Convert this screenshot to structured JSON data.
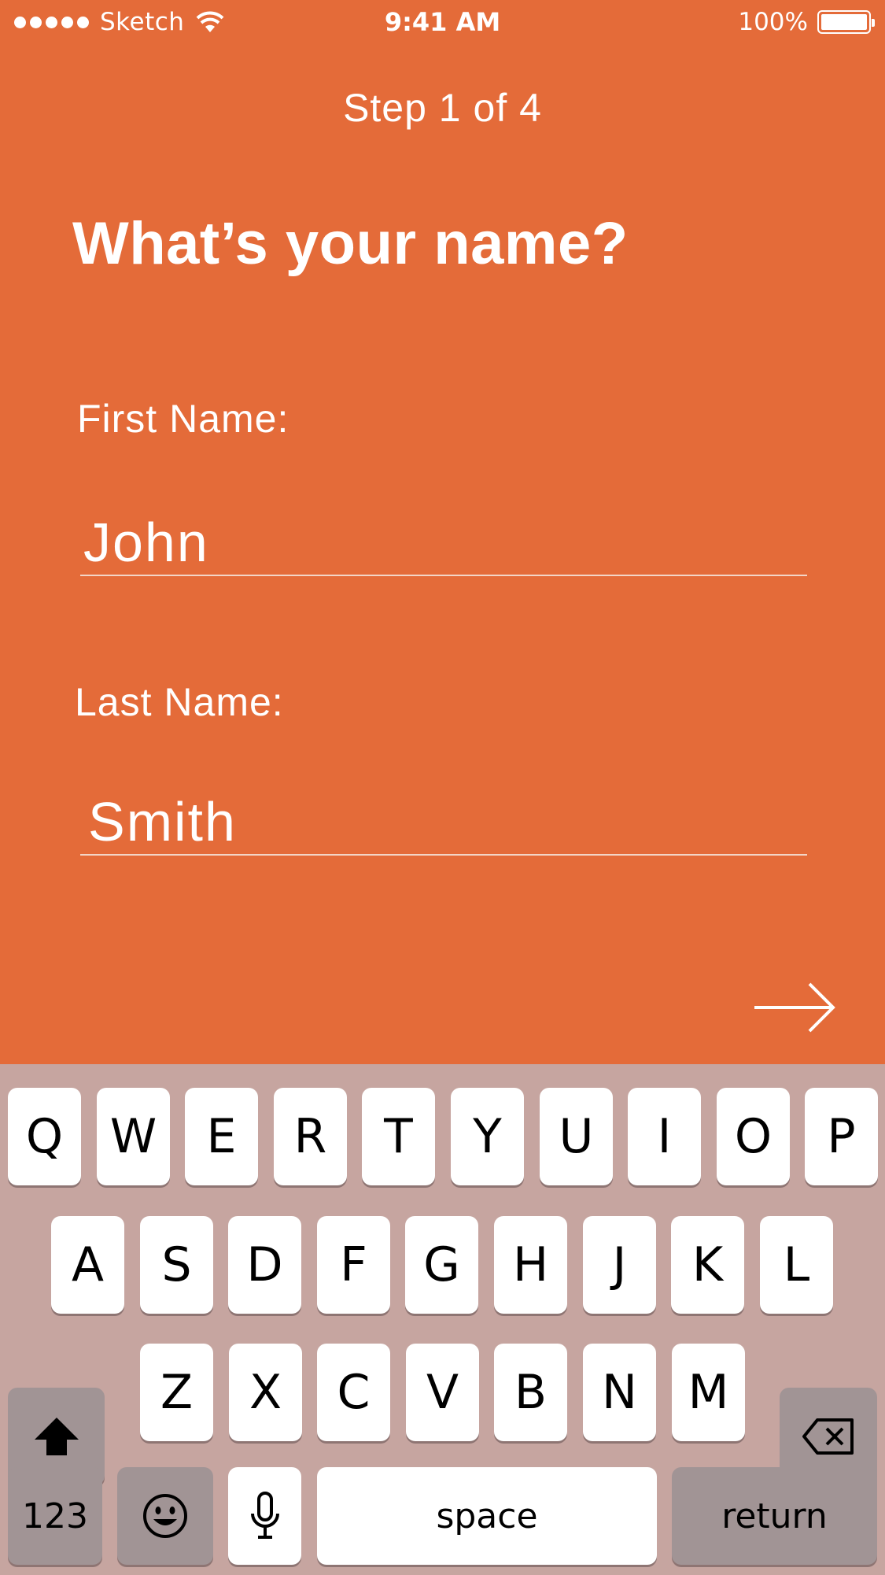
{
  "status_bar": {
    "carrier": "Sketch",
    "time": "9:41 AM",
    "battery": "100%",
    "icons": [
      "signal-dots",
      "wifi-icon",
      "battery-icon"
    ]
  },
  "step": "Step 1 of 4",
  "title": "What’s your name?",
  "form": {
    "first_name_label": "First Name:",
    "first_name_value": "John",
    "last_name_label": "Last Name:",
    "last_name_value": "Smith"
  },
  "next_icon": "arrow-right-icon",
  "keyboard": {
    "row1": [
      "Q",
      "W",
      "E",
      "R",
      "T",
      "Y",
      "U",
      "I",
      "O",
      "P"
    ],
    "row2": [
      "A",
      "S",
      "D",
      "F",
      "G",
      "H",
      "J",
      "K",
      "L"
    ],
    "row3": [
      "Z",
      "X",
      "C",
      "V",
      "B",
      "N",
      "M"
    ],
    "shift_icon": "shift-icon",
    "delete_icon": "delete-icon",
    "numbers_label": "123",
    "emoji_icon": "emoji-icon",
    "mic_icon": "microphone-icon",
    "space_label": "space",
    "return_label": "return"
  },
  "colors": {
    "background": "#E46B39",
    "keyboard": "#C6A5A0",
    "key": "#FFFFFF",
    "special_key": "#A19495"
  }
}
